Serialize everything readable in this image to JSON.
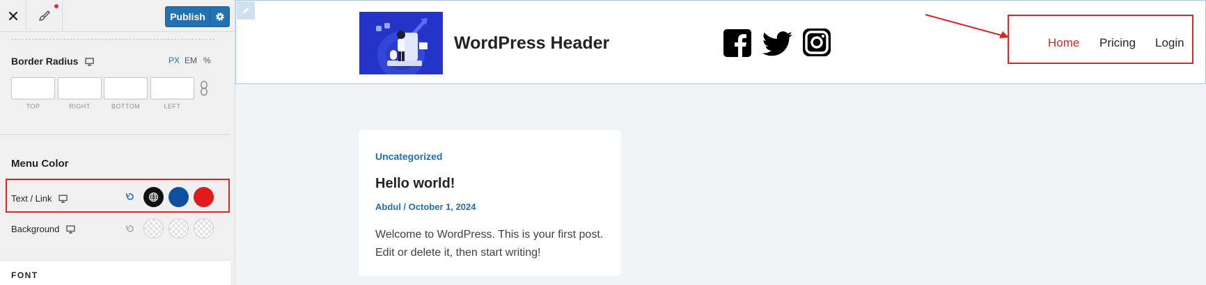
{
  "toolbar": {
    "publish_label": "Publish",
    "icons": [
      "close-icon",
      "brush-icon",
      "gear-icon"
    ]
  },
  "border_radius": {
    "title": "Border Radius",
    "units": [
      "PX",
      "EM",
      "%"
    ],
    "active_unit": "PX",
    "fields": [
      {
        "label": "TOP",
        "value": ""
      },
      {
        "label": "RIGHT",
        "value": ""
      },
      {
        "label": "BOTTOM",
        "value": ""
      },
      {
        "label": "LEFT",
        "value": ""
      }
    ]
  },
  "menu_color": {
    "title": "Menu Color",
    "text_link": {
      "label": "Text / Link",
      "swatches": [
        "#111111",
        "#0d4fa0",
        "#e01b1b"
      ]
    },
    "background": {
      "label": "Background",
      "swatches": [
        "transparent",
        "transparent",
        "transparent"
      ]
    }
  },
  "font_section": {
    "title": "FONT"
  },
  "preview": {
    "site_title": "WordPress Header",
    "social_icons": [
      "facebook-icon",
      "twitter-icon",
      "instagram-icon"
    ],
    "nav": [
      {
        "label": "Home",
        "current": true
      },
      {
        "label": "Pricing",
        "current": false
      },
      {
        "label": "Login",
        "current": false
      }
    ],
    "post": {
      "category": "Uncategorized",
      "title": "Hello world!",
      "meta": "Abdul / October 1, 2024",
      "excerpt": "Welcome to WordPress. This is your first post. Edit or delete it, then start writing!"
    }
  },
  "colors": {
    "accent": "#2271b1",
    "highlight_box": "#e02424",
    "nav_current": "#cc2a2a"
  }
}
